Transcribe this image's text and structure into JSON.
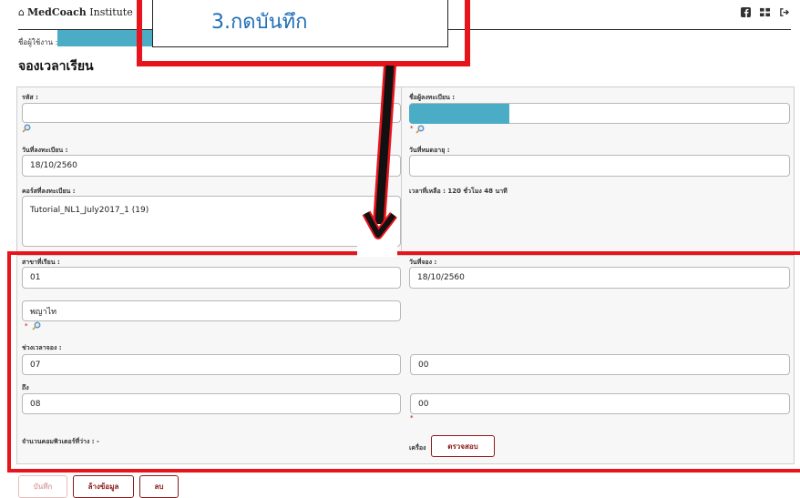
{
  "navbar": {
    "home_glyph": "⌂",
    "brand_bold": "MedCoach",
    "brand_rest": "Institute",
    "icons": [
      "facebook-icon",
      "grid-icon",
      "signout-icon"
    ]
  },
  "user": {
    "label": "ชื่อผู้ใช้งาน :"
  },
  "page": {
    "title": "จองเวลาเรียน"
  },
  "form": {
    "code_label": "รหัส :",
    "code_value": "",
    "name_label": "ชื่อผู้ลงทะเบียน :",
    "name_required": "*",
    "reg_date_label": "วันที่ลงทะเบียน :",
    "reg_date_value": "18/10/2560",
    "expire_label": "วันที่หมดอายุ :",
    "expire_value": "",
    "course_label": "คอร์สที่ลงทะเบียน :",
    "course_value": "Tutorial_NL1_July2017_1 (19)",
    "remaining_text": "เวลาที่เหลือ : 120 ชั่วโมง 48 นาที",
    "branch_label": "สาขาที่เรียน :",
    "branch_code": "01",
    "branch_name": "พญาไท",
    "branch_required": "*",
    "booking_date_label": "วันที่จอง :",
    "booking_date_value": "18/10/2560",
    "time_label": "ช่วงเวลาจอง :",
    "from_hour": "07",
    "from_minute": "00",
    "to_label": "ถึง",
    "to_hour": "08",
    "to_minute": "00",
    "to_required": "*",
    "computers_text": "จำนวนคอมพิวเตอร์ที่ว่าง : -",
    "machine_label": "เครื่อง",
    "check_button": "ตรวจสอบ"
  },
  "actions": {
    "save": "บันทึก",
    "clear": "ล้างข้อมูล",
    "delete": "ลบ"
  },
  "annotation": {
    "callout": "3.กดบันทึก"
  },
  "colors": {
    "accent": "#8b1a1a",
    "highlight": "#4bacc6",
    "annotation_red": "#e8141b",
    "annotation_blue": "#1f6fb6"
  }
}
